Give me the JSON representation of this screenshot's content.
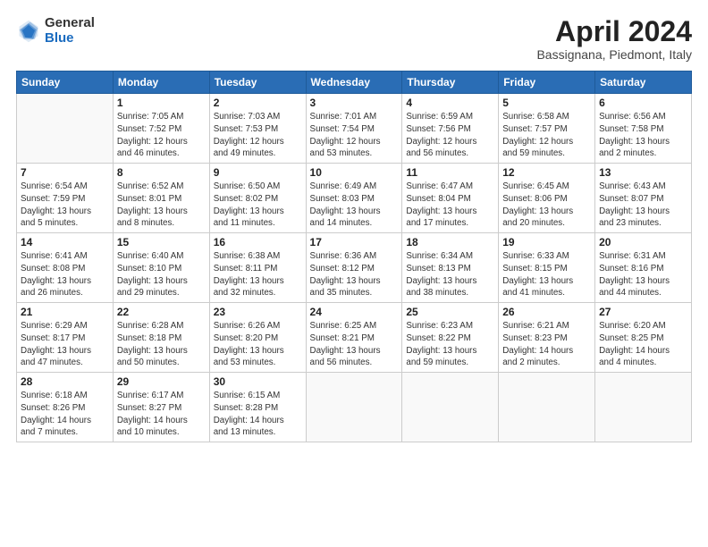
{
  "logo": {
    "general": "General",
    "blue": "Blue"
  },
  "title": {
    "month": "April 2024",
    "location": "Bassignana, Piedmont, Italy"
  },
  "weekdays": [
    "Sunday",
    "Monday",
    "Tuesday",
    "Wednesday",
    "Thursday",
    "Friday",
    "Saturday"
  ],
  "weeks": [
    [
      {
        "day": "",
        "info": ""
      },
      {
        "day": "1",
        "info": "Sunrise: 7:05 AM\nSunset: 7:52 PM\nDaylight: 12 hours\nand 46 minutes."
      },
      {
        "day": "2",
        "info": "Sunrise: 7:03 AM\nSunset: 7:53 PM\nDaylight: 12 hours\nand 49 minutes."
      },
      {
        "day": "3",
        "info": "Sunrise: 7:01 AM\nSunset: 7:54 PM\nDaylight: 12 hours\nand 53 minutes."
      },
      {
        "day": "4",
        "info": "Sunrise: 6:59 AM\nSunset: 7:56 PM\nDaylight: 12 hours\nand 56 minutes."
      },
      {
        "day": "5",
        "info": "Sunrise: 6:58 AM\nSunset: 7:57 PM\nDaylight: 12 hours\nand 59 minutes."
      },
      {
        "day": "6",
        "info": "Sunrise: 6:56 AM\nSunset: 7:58 PM\nDaylight: 13 hours\nand 2 minutes."
      }
    ],
    [
      {
        "day": "7",
        "info": "Sunrise: 6:54 AM\nSunset: 7:59 PM\nDaylight: 13 hours\nand 5 minutes."
      },
      {
        "day": "8",
        "info": "Sunrise: 6:52 AM\nSunset: 8:01 PM\nDaylight: 13 hours\nand 8 minutes."
      },
      {
        "day": "9",
        "info": "Sunrise: 6:50 AM\nSunset: 8:02 PM\nDaylight: 13 hours\nand 11 minutes."
      },
      {
        "day": "10",
        "info": "Sunrise: 6:49 AM\nSunset: 8:03 PM\nDaylight: 13 hours\nand 14 minutes."
      },
      {
        "day": "11",
        "info": "Sunrise: 6:47 AM\nSunset: 8:04 PM\nDaylight: 13 hours\nand 17 minutes."
      },
      {
        "day": "12",
        "info": "Sunrise: 6:45 AM\nSunset: 8:06 PM\nDaylight: 13 hours\nand 20 minutes."
      },
      {
        "day": "13",
        "info": "Sunrise: 6:43 AM\nSunset: 8:07 PM\nDaylight: 13 hours\nand 23 minutes."
      }
    ],
    [
      {
        "day": "14",
        "info": "Sunrise: 6:41 AM\nSunset: 8:08 PM\nDaylight: 13 hours\nand 26 minutes."
      },
      {
        "day": "15",
        "info": "Sunrise: 6:40 AM\nSunset: 8:10 PM\nDaylight: 13 hours\nand 29 minutes."
      },
      {
        "day": "16",
        "info": "Sunrise: 6:38 AM\nSunset: 8:11 PM\nDaylight: 13 hours\nand 32 minutes."
      },
      {
        "day": "17",
        "info": "Sunrise: 6:36 AM\nSunset: 8:12 PM\nDaylight: 13 hours\nand 35 minutes."
      },
      {
        "day": "18",
        "info": "Sunrise: 6:34 AM\nSunset: 8:13 PM\nDaylight: 13 hours\nand 38 minutes."
      },
      {
        "day": "19",
        "info": "Sunrise: 6:33 AM\nSunset: 8:15 PM\nDaylight: 13 hours\nand 41 minutes."
      },
      {
        "day": "20",
        "info": "Sunrise: 6:31 AM\nSunset: 8:16 PM\nDaylight: 13 hours\nand 44 minutes."
      }
    ],
    [
      {
        "day": "21",
        "info": "Sunrise: 6:29 AM\nSunset: 8:17 PM\nDaylight: 13 hours\nand 47 minutes."
      },
      {
        "day": "22",
        "info": "Sunrise: 6:28 AM\nSunset: 8:18 PM\nDaylight: 13 hours\nand 50 minutes."
      },
      {
        "day": "23",
        "info": "Sunrise: 6:26 AM\nSunset: 8:20 PM\nDaylight: 13 hours\nand 53 minutes."
      },
      {
        "day": "24",
        "info": "Sunrise: 6:25 AM\nSunset: 8:21 PM\nDaylight: 13 hours\nand 56 minutes."
      },
      {
        "day": "25",
        "info": "Sunrise: 6:23 AM\nSunset: 8:22 PM\nDaylight: 13 hours\nand 59 minutes."
      },
      {
        "day": "26",
        "info": "Sunrise: 6:21 AM\nSunset: 8:23 PM\nDaylight: 14 hours\nand 2 minutes."
      },
      {
        "day": "27",
        "info": "Sunrise: 6:20 AM\nSunset: 8:25 PM\nDaylight: 14 hours\nand 4 minutes."
      }
    ],
    [
      {
        "day": "28",
        "info": "Sunrise: 6:18 AM\nSunset: 8:26 PM\nDaylight: 14 hours\nand 7 minutes."
      },
      {
        "day": "29",
        "info": "Sunrise: 6:17 AM\nSunset: 8:27 PM\nDaylight: 14 hours\nand 10 minutes."
      },
      {
        "day": "30",
        "info": "Sunrise: 6:15 AM\nSunset: 8:28 PM\nDaylight: 14 hours\nand 13 minutes."
      },
      {
        "day": "",
        "info": ""
      },
      {
        "day": "",
        "info": ""
      },
      {
        "day": "",
        "info": ""
      },
      {
        "day": "",
        "info": ""
      }
    ]
  ]
}
